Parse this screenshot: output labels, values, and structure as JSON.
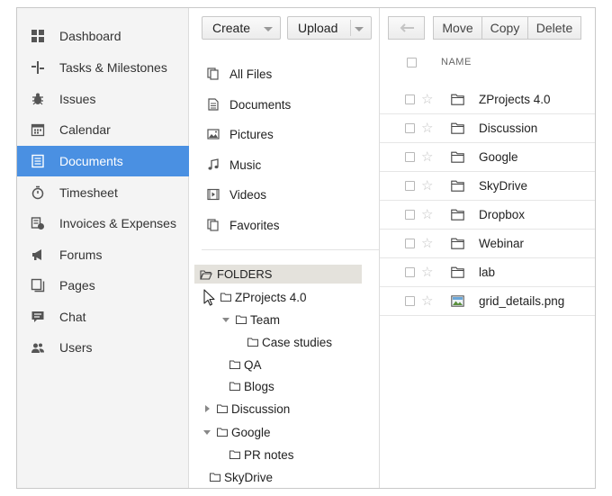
{
  "sidebar": {
    "items": [
      {
        "label": "Dashboard",
        "icon": "dashboard-icon",
        "active": false
      },
      {
        "label": "Tasks & Milestones",
        "icon": "tasks-icon",
        "active": false
      },
      {
        "label": "Issues",
        "icon": "bug-icon",
        "active": false
      },
      {
        "label": "Calendar",
        "icon": "calendar-icon",
        "active": false
      },
      {
        "label": "Documents",
        "icon": "document-icon",
        "active": true
      },
      {
        "label": "Timesheet",
        "icon": "stopwatch-icon",
        "active": false
      },
      {
        "label": "Invoices & Expenses",
        "icon": "invoice-icon",
        "active": false
      },
      {
        "label": "Forums",
        "icon": "megaphone-icon",
        "active": false
      },
      {
        "label": "Pages",
        "icon": "pages-icon",
        "active": false
      },
      {
        "label": "Chat",
        "icon": "chat-icon",
        "active": false
      },
      {
        "label": "Users",
        "icon": "users-icon",
        "active": false
      }
    ],
    "active_color": "#4a90e2"
  },
  "toolbar": {
    "create_label": "Create",
    "upload_label": "Upload",
    "move_label": "Move",
    "copy_label": "Copy",
    "delete_label": "Delete",
    "back_icon": "back-arrow-icon"
  },
  "library": {
    "items": [
      {
        "label": "All Files",
        "icon": "all-files-icon"
      },
      {
        "label": "Documents",
        "icon": "document-file-icon"
      },
      {
        "label": "Pictures",
        "icon": "picture-icon"
      },
      {
        "label": "Music",
        "icon": "music-icon"
      },
      {
        "label": "Videos",
        "icon": "video-icon"
      },
      {
        "label": "Favorites",
        "icon": "favorites-icon"
      }
    ]
  },
  "folders": {
    "header": "FOLDERS",
    "tree": [
      {
        "label": "ZProjects 4.0",
        "toggle": "none"
      },
      {
        "label": "Team",
        "toggle": "expanded"
      },
      {
        "label": "Case studies",
        "toggle": "none"
      },
      {
        "label": "QA",
        "toggle": "none"
      },
      {
        "label": "Blogs",
        "toggle": "none"
      },
      {
        "label": "Discussion",
        "toggle": "collapsed"
      },
      {
        "label": "Google",
        "toggle": "expanded"
      },
      {
        "label": "PR notes",
        "toggle": "none"
      },
      {
        "label": "SkyDrive",
        "toggle": "none"
      }
    ]
  },
  "list": {
    "column_name": "NAME",
    "rows": [
      {
        "name": "ZProjects 4.0",
        "type": "folder"
      },
      {
        "name": "Discussion",
        "type": "folder"
      },
      {
        "name": "Google",
        "type": "folder"
      },
      {
        "name": "SkyDrive",
        "type": "folder"
      },
      {
        "name": "Dropbox",
        "type": "folder"
      },
      {
        "name": "Webinar",
        "type": "folder"
      },
      {
        "name": "lab",
        "type": "folder"
      },
      {
        "name": "grid_details.png",
        "type": "image"
      }
    ]
  }
}
